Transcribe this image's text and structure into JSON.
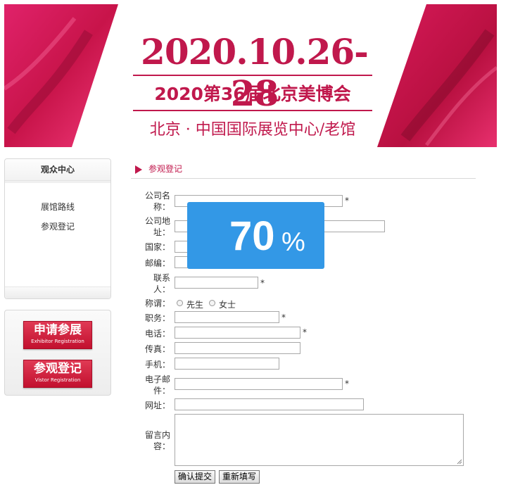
{
  "banner": {
    "date": "2020.10.26-28",
    "event": "2020第36届北京美博会",
    "venue": "北京 · 中国国际展览中心/老馆"
  },
  "sidebar": {
    "title": "观众中心",
    "links": [
      "展馆路线",
      "参观登记"
    ]
  },
  "registration_buttons": [
    {
      "cn": "申请参展",
      "en": "Exhibitor Registration"
    },
    {
      "cn": "参观登记",
      "en": "Vistor Registration"
    }
  ],
  "form": {
    "section_title": "参观登记",
    "fields": {
      "company_name": {
        "label1": "公司名",
        "label2": "称：",
        "required": "*"
      },
      "company_address": {
        "label1": "公司地",
        "label2": "址："
      },
      "country": {
        "label": "国家："
      },
      "postcode": {
        "label": "邮编："
      },
      "contact": {
        "label1": "联系",
        "label2": "人：",
        "required": "*"
      },
      "title": {
        "label": "称谓：",
        "options": [
          "先生",
          "女士"
        ]
      },
      "position": {
        "label": "职务：",
        "required": "*"
      },
      "phone": {
        "label": "电话：",
        "required": "*"
      },
      "fax": {
        "label": "传真："
      },
      "mobile": {
        "label": "手机："
      },
      "email": {
        "label1": "电子邮",
        "label2": "件：",
        "required": "*"
      },
      "website": {
        "label": "网址："
      },
      "message": {
        "label1": "留言内",
        "label2": "容："
      }
    },
    "submit_label": "确认提交",
    "reset_label": "重新填写"
  },
  "progress": {
    "value": "70",
    "unit": "%"
  },
  "colors": {
    "brand": "#c0184c",
    "overlay": "#3398e6"
  }
}
